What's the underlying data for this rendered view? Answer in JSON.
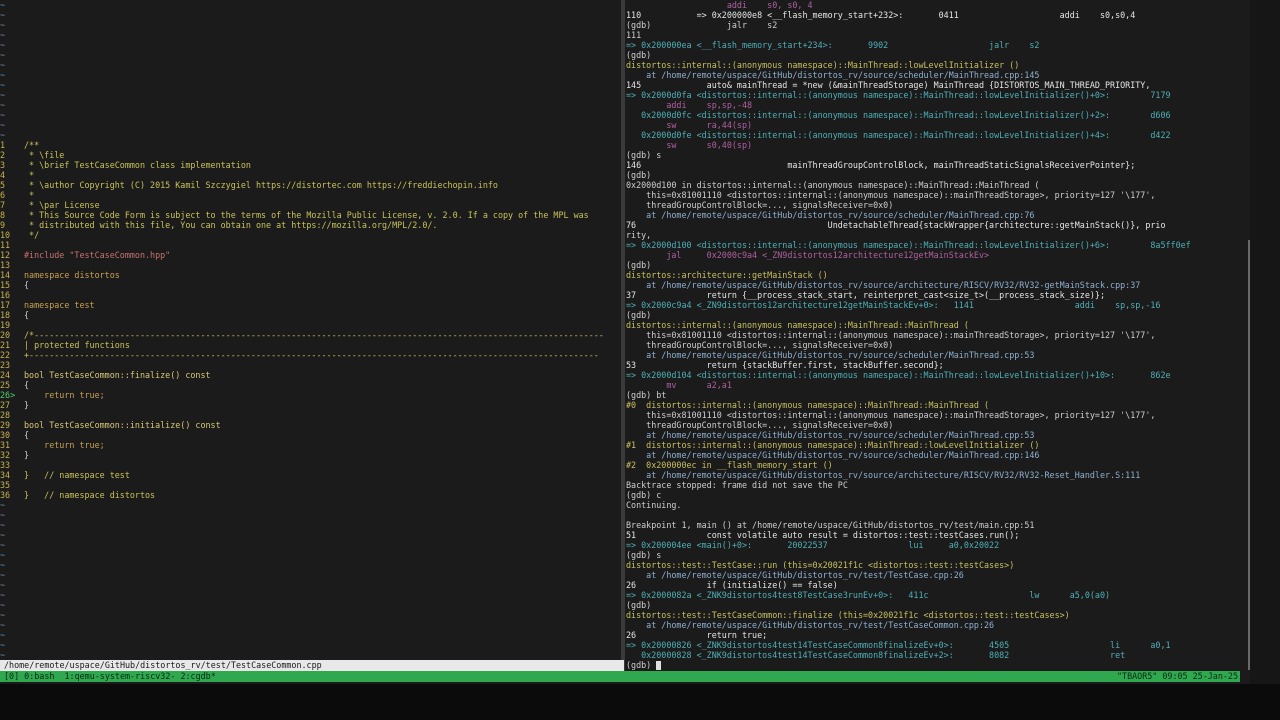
{
  "vim": {
    "tilde": "~",
    "source_lines": [
      {
        "n": "1",
        "t": "/**",
        "c": "cm"
      },
      {
        "n": "2",
        "t": " * \\file",
        "c": "cm"
      },
      {
        "n": "3",
        "t": " * \\brief TestCaseCommon class implementation",
        "c": "cm"
      },
      {
        "n": "4",
        "t": " *",
        "c": "cm"
      },
      {
        "n": "5",
        "t": " * \\author Copyright (C) 2015 Kamil Szczygiel https://distortec.com https://freddiechopin.info",
        "c": "cm"
      },
      {
        "n": "6",
        "t": " *",
        "c": "cm"
      },
      {
        "n": "7",
        "t": " * \\par License",
        "c": "cm"
      },
      {
        "n": "8",
        "t": " * This Source Code Form is subject to the terms of the Mozilla Public License, v. 2.0. If a copy of the MPL was",
        "c": "cm"
      },
      {
        "n": "9",
        "t": " * distributed with this file, You can obtain one at https://mozilla.org/MPL/2.0/.",
        "c": "cm"
      },
      {
        "n": "10",
        "t": " */",
        "c": "cm"
      },
      {
        "n": "11",
        "t": "",
        "c": ""
      },
      {
        "n": "12",
        "t": "#include \"TestCaseCommon.hpp\"",
        "c": "inc"
      },
      {
        "n": "13",
        "t": "",
        "c": ""
      },
      {
        "n": "14",
        "t": "namespace distortos",
        "c": "ns"
      },
      {
        "n": "15",
        "t": "{",
        "c": ""
      },
      {
        "n": "16",
        "t": "",
        "c": ""
      },
      {
        "n": "17",
        "t": "namespace test",
        "c": "ns"
      },
      {
        "n": "18",
        "t": "{",
        "c": ""
      },
      {
        "n": "19",
        "t": "",
        "c": ""
      },
      {
        "n": "20",
        "t": "/*-----------------------------------------------------------------------------------------------------------------",
        "c": "cm"
      },
      {
        "n": "21",
        "t": "| protected functions",
        "c": "cm"
      },
      {
        "n": "22",
        "t": "+-----------------------------------------------------------------------------------------------------------------",
        "c": "cm"
      },
      {
        "n": "23",
        "t": "",
        "c": ""
      },
      {
        "n": "24",
        "t": "bool TestCaseCommon::finalize() const",
        "c": "fn"
      },
      {
        "n": "25",
        "t": "{",
        "c": ""
      },
      {
        "n": "26",
        "t": "    return true;",
        "c": "ret"
      },
      {
        "n": "27",
        "t": "}",
        "c": ""
      },
      {
        "n": "28",
        "t": "",
        "c": ""
      },
      {
        "n": "29",
        "t": "bool TestCaseCommon::initialize() const",
        "c": "fn"
      },
      {
        "n": "30",
        "t": "{",
        "c": ""
      },
      {
        "n": "31",
        "t": "    return true;",
        "c": "ret"
      },
      {
        "n": "32",
        "t": "}",
        "c": ""
      },
      {
        "n": "33",
        "t": "",
        "c": ""
      },
      {
        "n": "34",
        "t": "}   // namespace test",
        "c": "end"
      },
      {
        "n": "35",
        "t": "",
        "c": ""
      },
      {
        "n": "36",
        "t": "}   // namespace distortos",
        "c": "end"
      }
    ],
    "current_line_marker": "26>",
    "status_path": "/home/remote/uspace/GitHub/distortos_rv/test/TestCaseCommon.cpp"
  },
  "gdb": {
    "lines": [
      "                    addi    s0, s0, 4",
      "110           => 0x200000e8 <__flash_memory_start+232>:       0411                    addi    s0,s0,4",
      "(gdb)               jalr    s2",
      "111",
      "=> 0x200000ea <__flash_memory_start+234>:       9902                    jalr    s2",
      "(gdb)",
      "distortos::internal::(anonymous namespace)::MainThread::lowLevelInitializer ()",
      "    at /home/remote/uspace/GitHub/distortos_rv/source/scheduler/MainThread.cpp:145",
      "145             auto& mainThread = *new (&mainThreadStorage) MainThread {DISTORTOS_MAIN_THREAD_PRIORITY,",
      "=> 0x2000d0fa <distortos::internal::(anonymous namespace)::MainThread::lowLevelInitializer()+0>:        7179",
      "        addi    sp,sp,-48",
      "   0x2000d0fc <distortos::internal::(anonymous namespace)::MainThread::lowLevelInitializer()+2>:        d606",
      "        sw      ra,44(sp)",
      "   0x2000d0fe <distortos::internal::(anonymous namespace)::MainThread::lowLevelInitializer()+4>:        d422",
      "        sw      s0,40(sp)",
      "(gdb) s",
      "146                             mainThreadGroupControlBlock, mainThreadStaticSignalsReceiverPointer};",
      "(gdb)",
      "0x2000d100 in distortos::internal::(anonymous namespace)::MainThread::MainThread (",
      "    this=0x81001110 <distortos::internal::(anonymous namespace)::mainThreadStorage>, priority=127 '\\177',",
      "    threadGroupControlBlock=..., signalsReceiver=0x0)",
      "    at /home/remote/uspace/GitHub/distortos_rv/source/scheduler/MainThread.cpp:76",
      "76                                      UndetachableThread{stackWrapper{architecture::getMainStack()}, prio",
      "rity,",
      "=> 0x2000d100 <distortos::internal::(anonymous namespace)::MainThread::lowLevelInitializer()+6>:        8a5ff0ef",
      "        jal     0x2000c9a4 <_ZN9distortos12architecture12getMainStackEv>",
      "(gdb)",
      "distortos::architecture::getMainStack ()",
      "    at /home/remote/uspace/GitHub/distortos_rv/source/architecture/RISCV/RV32/RV32-getMainStack.cpp:37",
      "37              return {__process_stack_start, reinterpret_cast<size_t>(__process_stack_size)};",
      "=> 0x2000c9a4 <_ZN9distortos12architecture12getMainStackEv+0>:   1141                    addi    sp,sp,-16",
      "(gdb)",
      "distortos::internal::(anonymous namespace)::MainThread::MainThread (",
      "    this=0x81001110 <distortos::internal::(anonymous namespace)::mainThreadStorage>, priority=127 '\\177',",
      "    threadGroupControlBlock=..., signalsReceiver=0x0)",
      "    at /home/remote/uspace/GitHub/distortos_rv/source/scheduler/MainThread.cpp:53",
      "53              return {stackBuffer.first, stackBuffer.second};",
      "=> 0x2000d104 <distortos::internal::(anonymous namespace)::MainThread::lowLevelInitializer()+10>:       862e",
      "        mv      a2,a1",
      "(gdb) bt",
      "#0  distortos::internal::(anonymous namespace)::MainThread::MainThread (",
      "    this=0x81001110 <distortos::internal::(anonymous namespace)::mainThreadStorage>, priority=127 '\\177',",
      "    threadGroupControlBlock=..., signalsReceiver=0x0)",
      "    at /home/remote/uspace/GitHub/distortos_rv/source/scheduler/MainThread.cpp:53",
      "#1  distortos::internal::(anonymous namespace)::MainThread::lowLevelInitializer ()",
      "    at /home/remote/uspace/GitHub/distortos_rv/source/scheduler/MainThread.cpp:146",
      "#2  0x200000ec in __flash_memory_start ()",
      "    at /home/remote/uspace/GitHub/distortos_rv/source/architecture/RISCV/RV32/RV32-Reset_Handler.S:111",
      "Backtrace stopped: frame did not save the PC",
      "(gdb) c",
      "Continuing.",
      "",
      "Breakpoint 1, main () at /home/remote/uspace/GitHub/distortos_rv/test/main.cpp:51",
      "51              const volatile auto result = distortos::test::testCases.run();",
      "=> 0x200004ee <main()+0>:       20022537                lui     a0,0x20022",
      "(gdb) s",
      "distortos::test::TestCase::run (this=0x20021f1c <distortos::test::testCases>)",
      "    at /home/remote/uspace/GitHub/distortos_rv/test/TestCase.cpp:26",
      "26              if (initialize() == false)",
      "=> 0x2000082a <_ZNK9distortos4test8TestCase3runEv+0>:   411c                    lw      a5,0(a0)",
      "(gdb)",
      "distortos::test::TestCaseCommon::finalize (this=0x20021f1c <distortos::test::testCases>)",
      "    at /home/remote/uspace/GitHub/distortos_rv/test/TestCaseCommon.cpp:26",
      "26              return true;",
      "=> 0x20000826 <_ZNK9distortos4test14TestCaseCommon8finalizeEv+0>:       4505                    li      a0,1",
      "   0x20000828 <_ZNK9distortos4test14TestCaseCommon8finalizeEv+2>:       8082                    ret",
      "(gdb) "
    ]
  },
  "tmux": {
    "windows": "[0] 0:bash  1:qemu-system-riscv32- 2:cgdb*",
    "right_status": "\"TBAOR5\" 09:05 25-Jan-25"
  }
}
